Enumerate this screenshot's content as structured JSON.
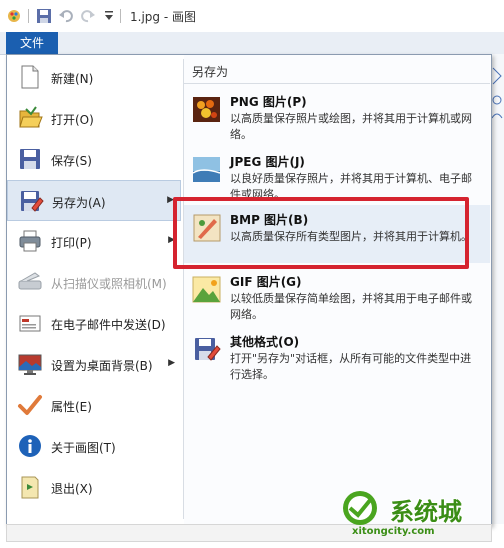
{
  "window": {
    "title": "1.jpg - 画图"
  },
  "ribbon": {
    "file_tab": "文件"
  },
  "left_menu": [
    {
      "name": "new",
      "label": "新建(N)",
      "icon": "new-file-icon"
    },
    {
      "name": "open",
      "label": "打开(O)",
      "icon": "open-folder-icon"
    },
    {
      "name": "save",
      "label": "保存(S)",
      "icon": "save-disk-icon"
    },
    {
      "name": "save-as",
      "label": "另存为(A)",
      "icon": "save-as-icon",
      "has_submenu": true,
      "selected": true
    },
    {
      "name": "print",
      "label": "打印(P)",
      "icon": "printer-icon",
      "has_submenu": true
    },
    {
      "name": "scanner",
      "label": "从扫描仪或照相机(M)",
      "icon": "scanner-icon",
      "disabled": true
    },
    {
      "name": "email",
      "label": "在电子邮件中发送(D)",
      "icon": "email-icon"
    },
    {
      "name": "desktop-bg",
      "label": "设置为桌面背景(B)",
      "icon": "desktop-icon",
      "has_submenu": true
    },
    {
      "name": "properties",
      "label": "属性(E)",
      "icon": "checkmark-icon"
    },
    {
      "name": "about",
      "label": "关于画图(T)",
      "icon": "info-icon"
    },
    {
      "name": "exit",
      "label": "退出(X)",
      "icon": "exit-icon"
    }
  ],
  "submenu": {
    "header": "另存为",
    "items": [
      {
        "name": "png",
        "title": "PNG 图片(P)",
        "desc": "以高质量保存照片或绘图，并将其用于计算机或网络。",
        "icon": "png-image-icon"
      },
      {
        "name": "jpeg",
        "title": "JPEG 图片(J)",
        "desc": "以良好质量保存照片，并将其用于计算机、电子邮件或网络。",
        "icon": "jpeg-image-icon"
      },
      {
        "name": "bmp",
        "title": "BMP 图片(B)",
        "desc": "以高质量保存所有类型图片，并将其用于计算机。",
        "icon": "bmp-image-icon",
        "highlighted": true
      },
      {
        "name": "gif",
        "title": "GIF 图片(G)",
        "desc": "以较低质量保存简单绘图，并将其用于电子邮件或网络。",
        "icon": "gif-image-icon"
      },
      {
        "name": "other",
        "title": "其他格式(O)",
        "desc": "打开\"另存为\"对话框，从所有可能的文件类型中进行选择。",
        "icon": "other-format-icon"
      }
    ]
  },
  "watermark": {
    "text": "系统城",
    "sub": "xitongcity.com"
  },
  "colors": {
    "file_tab": "#1b5fb0",
    "highlight_box": "#d5232f",
    "watermark": "#3b8e16"
  }
}
